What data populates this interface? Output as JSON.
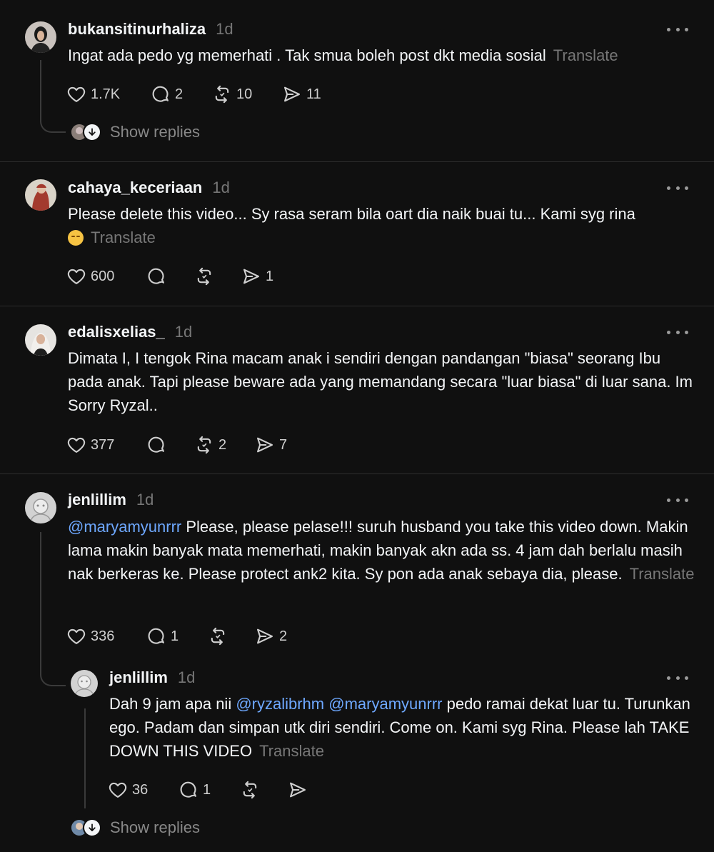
{
  "comments": [
    {
      "username": "bukansitinurhaliza",
      "time": "1d",
      "text": "Ingat ada pedo yg memerhati . Tak smua boleh post dkt media sosial",
      "translate": "Translate",
      "likes": "1.7K",
      "replies": "2",
      "reposts": "10",
      "shares": "11",
      "show_replies": "Show replies"
    },
    {
      "username": "cahaya_keceriaan",
      "time": "1d",
      "text_line1": "Please delete this video... Sy rasa seram bila oart dia naik buai tu... Kami syg rina",
      "translate": "Translate",
      "likes": "600",
      "replies": "",
      "reposts": "",
      "shares": "1"
    },
    {
      "username": "edalisxelias_",
      "time": "1d",
      "text": "Dimata I, I tengok Rina macam anak i sendiri dengan pandangan \"biasa\" seorang Ibu pada anak. Tapi please beware ada yang memandang secara \"luar biasa\" di luar sana. Im Sorry Ryzal..",
      "likes": "377",
      "replies": "",
      "reposts": "2",
      "shares": "7"
    },
    {
      "username": "jenlillim",
      "time": "1d",
      "mention": "@maryamyunrrr",
      "text": " Please, please pelase!!! suruh husband you take this video down. Makin lama makin banyak mata memerhati, makin banyak akn ada ss. 4 jam dah berlalu masih nak berkeras ke. Please protect ank2 kita. Sy pon ada anak sebaya dia, please.",
      "translate": "Translate",
      "likes": "336",
      "replies": "1",
      "reposts": "",
      "shares": "2"
    },
    {
      "username": "jenlillim",
      "time": "1d",
      "text_a": "Dah 9 jam apa nii ",
      "mention1": "@ryzalibrhm",
      "mention2": "@maryamyunrrr",
      "text_b": " pedo ramai dekat luar tu. Turunkan ego. Padam dan simpan utk diri sendiri. Come on. Kami syg Rina. Please lah TAKE DOWN THIS VIDEO",
      "translate": "Translate",
      "likes": "36",
      "replies": "1",
      "reposts": "",
      "shares": "",
      "show_replies": "Show replies"
    }
  ],
  "colors": {
    "background": "#101010",
    "text": "#f3f5f7",
    "muted": "#777777",
    "mention": "#6ea8ff"
  },
  "icons": [
    "heart-icon",
    "comment-icon",
    "repost-icon",
    "share-icon",
    "more-icon",
    "arrow-down-icon"
  ]
}
